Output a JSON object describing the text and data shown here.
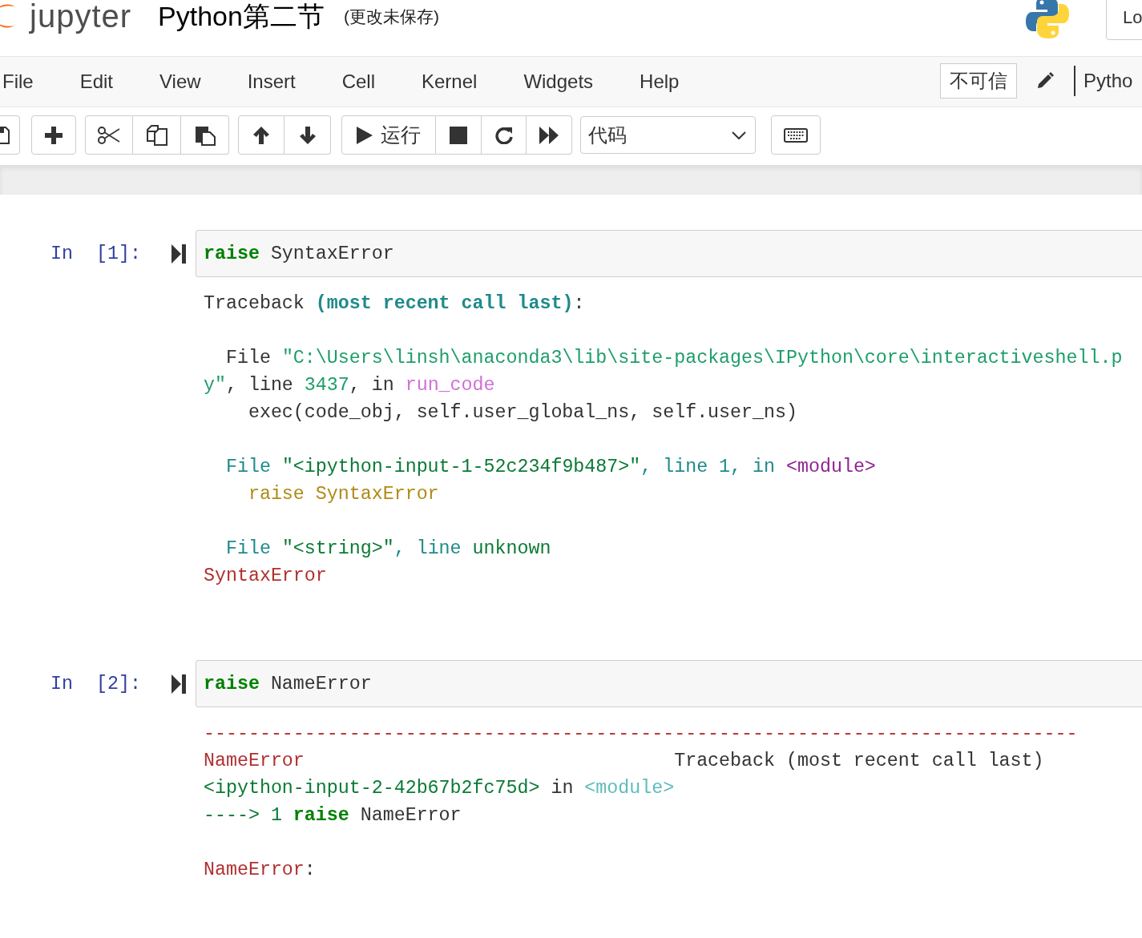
{
  "header": {
    "logo_text": "jupyter",
    "notebook_title": "Python第二节",
    "save_status": "(更改未保存)",
    "logout_button": "Lo"
  },
  "menu": [
    "File",
    "Edit",
    "View",
    "Insert",
    "Cell",
    "Kernel",
    "Widgets",
    "Help"
  ],
  "trust_indicator": "不可信",
  "kernel_name": "Pytho",
  "toolbar": {
    "run_label": "运行",
    "cell_type": "代码"
  },
  "cells": [
    {
      "prompt": "In [1]:",
      "code": [
        {
          "kind": "keyword",
          "text": "raise"
        },
        {
          "kind": "plain",
          "text": " SyntaxError"
        }
      ],
      "output": [
        {
          "kind": "text",
          "segments": [
            {
              "kind": "plain",
              "text": "Traceback "
            },
            {
              "kind": "heading",
              "text": "(most recent call last)"
            },
            {
              "kind": "plain",
              "text": ":"
            }
          ]
        },
        {
          "kind": "blank"
        },
        {
          "kind": "text",
          "segments": [
            {
              "kind": "plain",
              "text": "  File "
            },
            {
              "kind": "string",
              "text": "\"C:\\Users\\linsh\\anaconda3\\lib\\site-packages\\IPython\\core\\interactiveshell.p"
            }
          ]
        },
        {
          "kind": "text",
          "segments": [
            {
              "kind": "string",
              "text": "y\""
            },
            {
              "kind": "plain",
              "text": ", line "
            },
            {
              "kind": "string",
              "text": "3437"
            },
            {
              "kind": "plain",
              "text": ", in "
            },
            {
              "kind": "function",
              "text": "run_code"
            }
          ]
        },
        {
          "kind": "text",
          "segments": [
            {
              "kind": "plain",
              "text": "    exec(code_obj, self.user_global_ns, self.user_ns)"
            }
          ]
        },
        {
          "kind": "blank"
        },
        {
          "kind": "text",
          "segments": [
            {
              "kind": "frame",
              "text": "  File "
            },
            {
              "kind": "filename",
              "text": "\"<ipython-input-1-52c234f9b487>\""
            },
            {
              "kind": "frame",
              "text": ", line 1, in "
            },
            {
              "kind": "module",
              "text": "<module>"
            }
          ]
        },
        {
          "kind": "text",
          "segments": [
            {
              "kind": "source",
              "text": "    raise SyntaxError"
            }
          ]
        },
        {
          "kind": "blank"
        },
        {
          "kind": "text",
          "segments": [
            {
              "kind": "frame",
              "text": "  File "
            },
            {
              "kind": "filename",
              "text": "\"<string>\""
            },
            {
              "kind": "frame",
              "text": ", line "
            },
            {
              "kind": "filename",
              "text": "unknown"
            }
          ]
        },
        {
          "kind": "text",
          "segments": [
            {
              "kind": "error",
              "text": "SyntaxError"
            }
          ]
        }
      ]
    },
    {
      "prompt": "In [2]:",
      "code": [
        {
          "kind": "keyword",
          "text": "raise"
        },
        {
          "kind": "plain",
          "text": " NameError"
        }
      ],
      "output": [
        {
          "kind": "text",
          "segments": [
            {
              "kind": "error",
              "text": "------------------------------------------------------------------------------"
            }
          ]
        },
        {
          "kind": "text",
          "segments": [
            {
              "kind": "error",
              "text": "NameError"
            },
            {
              "kind": "plain",
              "text": "                                 Traceback (most recent call last)"
            }
          ]
        },
        {
          "kind": "text",
          "segments": [
            {
              "kind": "filename",
              "text": "<ipython-input-2-42b67b2fc75d>"
            },
            {
              "kind": "plain",
              "text": " in "
            },
            {
              "kind": "link",
              "text": "<module>"
            }
          ]
        },
        {
          "kind": "text",
          "segments": [
            {
              "kind": "filename",
              "text": "----> 1 "
            },
            {
              "kind": "keyword",
              "text": "raise"
            },
            {
              "kind": "plain",
              "text": " NameError"
            }
          ]
        },
        {
          "kind": "blank"
        },
        {
          "kind": "text",
          "segments": [
            {
              "kind": "error",
              "text": "NameError"
            },
            {
              "kind": "plain",
              "text": ":"
            }
          ]
        }
      ]
    }
  ]
}
